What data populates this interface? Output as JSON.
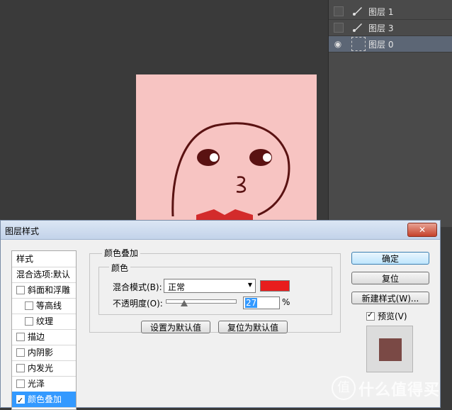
{
  "layers_panel": {
    "rows": [
      {
        "name": "图层 1",
        "visible": false,
        "icon": "brush-icon"
      },
      {
        "name": "图层 3",
        "visible": false,
        "icon": "brush-icon"
      },
      {
        "name": "图层 0",
        "visible": true,
        "icon": "layer-thumbnail-icon",
        "selected": true
      }
    ]
  },
  "canvas": {
    "background_color": "#f7c4c2",
    "face_text": "3"
  },
  "dialog": {
    "title": "图层样式",
    "close_label": "✕",
    "styles_list": [
      {
        "label": "样式",
        "checkbox": false
      },
      {
        "label": "混合选项:默认",
        "checkbox": false
      },
      {
        "label": "斜面和浮雕",
        "checkbox": true,
        "checked": false
      },
      {
        "label": "等高线",
        "checkbox": true,
        "checked": false,
        "indent": true
      },
      {
        "label": "纹理",
        "checkbox": true,
        "checked": false,
        "indent": true
      },
      {
        "label": "描边",
        "checkbox": true,
        "checked": false
      },
      {
        "label": "内阴影",
        "checkbox": true,
        "checked": false
      },
      {
        "label": "内发光",
        "checkbox": true,
        "checked": false
      },
      {
        "label": "光泽",
        "checkbox": true,
        "checked": false
      },
      {
        "label": "颜色叠加",
        "checkbox": true,
        "checked": true,
        "active": true
      }
    ],
    "section_title": "颜色叠加",
    "subsection_title": "颜色",
    "blend_mode_label": "混合模式(B):",
    "blend_mode_value": "正常",
    "overlay_color": "#e81d1d",
    "opacity_label": "不透明度(O):",
    "opacity_value": "27",
    "opacity_unit": "%",
    "set_default_label": "设置为默认值",
    "reset_default_label": "复位为默认值",
    "ok_label": "确定",
    "reset_label": "复位",
    "new_style_label": "新建样式(W)...",
    "preview_label": "预览(V)",
    "preview_checked": true,
    "preview_color": "#7a4945"
  },
  "watermark": {
    "logo_text": "值",
    "text": "什么值得买"
  }
}
